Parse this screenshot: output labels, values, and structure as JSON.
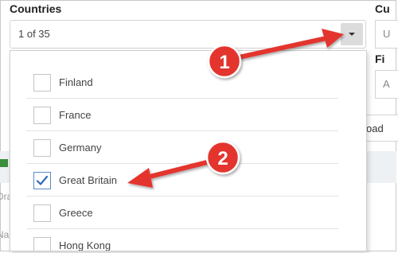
{
  "field": {
    "label": "Countries",
    "selected_summary": "1 of 35"
  },
  "side": {
    "label_top": "Cu",
    "label_mid": "Fi",
    "box_top_text": "U",
    "box_mid_text": "A",
    "button_text": "oad"
  },
  "background": {
    "text_1": "Dra",
    "text_2": "Na"
  },
  "options": [
    {
      "label": "Finland",
      "checked": false
    },
    {
      "label": "France",
      "checked": false
    },
    {
      "label": "Germany",
      "checked": false
    },
    {
      "label": "Great Britain",
      "checked": true
    },
    {
      "label": "Greece",
      "checked": false
    },
    {
      "label": "Hong Kong",
      "checked": false
    }
  ],
  "callouts": [
    {
      "number": "1"
    },
    {
      "number": "2"
    }
  ],
  "colors": {
    "callout_red": "#e3342f",
    "check_blue": "#2f6db5"
  }
}
